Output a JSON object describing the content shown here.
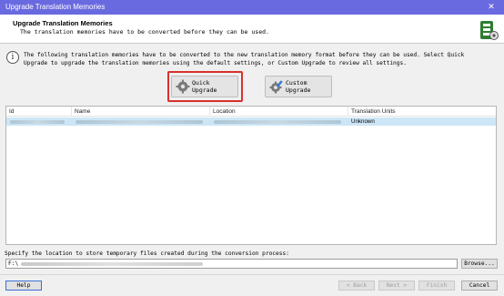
{
  "window": {
    "title": "Upgrade Translation Memories",
    "close_glyph": "✕"
  },
  "header": {
    "title": "Upgrade Translation Memories",
    "subtitle": "The translation memories have to be converted before they can be used."
  },
  "info": {
    "icon": "info-icon",
    "text": "The following translation memories have to be converted to the new translation memory format before they can be used. Select Quick Upgrade to upgrade the translation memories using the default settings, or Custom Upgrade to review all settings."
  },
  "actions": {
    "quick_upgrade": "Quick Upgrade",
    "custom_upgrade": "Custom Upgrade"
  },
  "table": {
    "columns": [
      "Id",
      "Name",
      "Location",
      "Translation Units"
    ],
    "rows": [
      {
        "translation_units": "Unknown"
      }
    ]
  },
  "location": {
    "label": "Specify the location to store temporary files created during the conversion process:",
    "value": "F:\\",
    "browse": "Browse..."
  },
  "footer": {
    "help": "Help",
    "back": "< Back",
    "next": "Next >",
    "finish": "Finish",
    "cancel": "Cancel"
  },
  "colors": {
    "highlight": "#d9302c",
    "title_bar": "#6a6ae0",
    "selected_row": "#cde6f7"
  }
}
